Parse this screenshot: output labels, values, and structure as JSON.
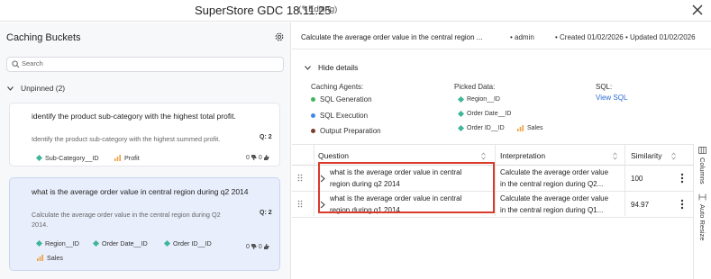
{
  "window": {
    "title": "SuperStore GDC 18.11.25",
    "edit_badge": "(✎Editing)",
    "icons": [
      "edit-icon",
      "close-icon"
    ]
  },
  "sidebar": {
    "title": "Caching Buckets",
    "search_placeholder": "Search",
    "group_label": "Unpinned (2)",
    "cards": [
      {
        "title": "identify the product sub-category with the highest total profit.",
        "description": "Identify the product sub-category with the highest summed profit.",
        "question_count": "Q: 2",
        "tags": [
          {
            "label": "Sub-Category__ID",
            "kind": "dimension"
          },
          {
            "label": "Profit",
            "kind": "measure"
          }
        ],
        "votes_up": "0",
        "votes_down": "0"
      },
      {
        "title": "what is the average order value in central region during q2 2014",
        "description_line1": "Calculate the average order value in the central region during Q2",
        "description_line2": "2014.",
        "question_count": "Q: 2",
        "tags": [
          {
            "label": "Region__ID",
            "kind": "dimension"
          },
          {
            "label": "Order Date__ID",
            "kind": "dimension"
          },
          {
            "label": "Order ID__ID",
            "kind": "dimension"
          },
          {
            "label": "Sales",
            "kind": "measure"
          }
        ],
        "votes_up": "0",
        "votes_down": "0"
      }
    ]
  },
  "detail": {
    "question": "Calculate the average order value in the central region ...",
    "author": "admin",
    "created": "Created 01/02/2026",
    "updated": "Updated 01/02/2026",
    "hide_details": "Hide details",
    "caching_agents_label": "Caching Agents:",
    "agents": [
      {
        "label": "SQL Generation",
        "color": "#3fb559"
      },
      {
        "label": "SQL Execution",
        "color": "#3d8be0"
      },
      {
        "label": "Output Preparation",
        "color": "#7a3f2a"
      }
    ],
    "picked_data_label": "Picked Data:",
    "picked": [
      {
        "label": "Region__ID",
        "kind": "dimension"
      },
      {
        "label": "Order Date__ID",
        "kind": "dimension"
      },
      {
        "label": "Order ID__ID",
        "kind": "dimension"
      },
      {
        "label": "Sales",
        "kind": "measure"
      }
    ],
    "sql_label": "SQL:",
    "view_sql": "View SQL"
  },
  "table": {
    "columns": [
      "Question",
      "Interpretation",
      "Similarity"
    ],
    "rows": [
      {
        "question_l1": "what is the average order value in central",
        "question_l2": "region during q2 2014",
        "interp_l1": "Calculate the average order value",
        "interp_l2": "in the central region during Q2...",
        "similarity": "100"
      },
      {
        "question_l1": "what is the average order value in central",
        "question_l2": "region during q1 2014",
        "interp_l1": "Calculate the average order value",
        "interp_l2": "in the central region during Q1...",
        "similarity": "94.97"
      }
    ],
    "side_tabs": [
      "Columns",
      "Auto Resize"
    ]
  },
  "colors": {
    "accent": "#2c6bd6",
    "dimension": "#3fb59a",
    "measure": "#f0a040",
    "highlight": "#d93b2b",
    "selected_card": "#e8eefb"
  }
}
